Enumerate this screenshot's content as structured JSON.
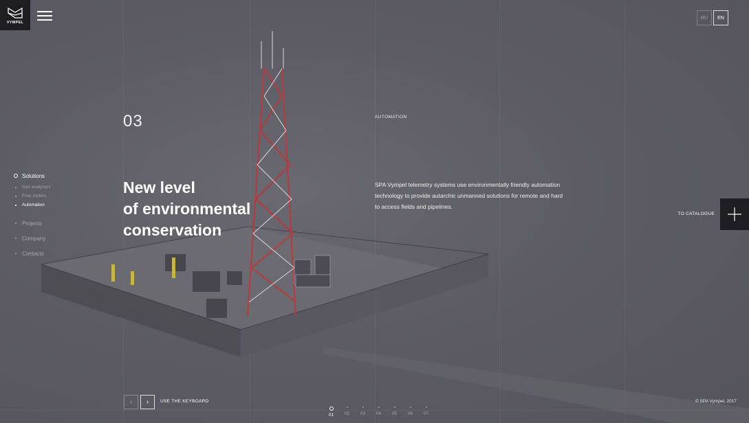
{
  "brand": {
    "name": "VYMPEL"
  },
  "lang": {
    "ru": "RU",
    "en": "EN",
    "active": "EN"
  },
  "nav": {
    "items": [
      {
        "label": "Solutions",
        "active": true
      },
      {
        "label": "Projects"
      },
      {
        "label": "Company"
      },
      {
        "label": "Contacts"
      }
    ],
    "sub_items": [
      {
        "label": "Gas analyzers"
      },
      {
        "label": "Flow meters"
      },
      {
        "label": "Automation",
        "active": true
      }
    ]
  },
  "slide": {
    "number": "03",
    "headline_lines": [
      "New level",
      "of environmental",
      "conservation"
    ],
    "category": "AUTOMATION",
    "description": "SPA Vympel telemetry systems use environmentally friendly automation technology to provide autarchic unmanned solutions for remote and hard to access fields and pipelines."
  },
  "catalogue": {
    "label": "TO CATALOGUE",
    "icon": "plus-icon"
  },
  "controls": {
    "prev": "‹",
    "next": "›",
    "keyboard_hint": "USE THE KEYBOARD"
  },
  "pagination": [
    "01",
    "02",
    "03",
    "04",
    "05",
    "06",
    "07"
  ],
  "footer": {
    "copyright": "© SPA Vympel, 2017"
  },
  "colors": {
    "background": "#5d5c64",
    "dark_panel": "#1e1d22",
    "tower_red": "#b83a3a"
  }
}
